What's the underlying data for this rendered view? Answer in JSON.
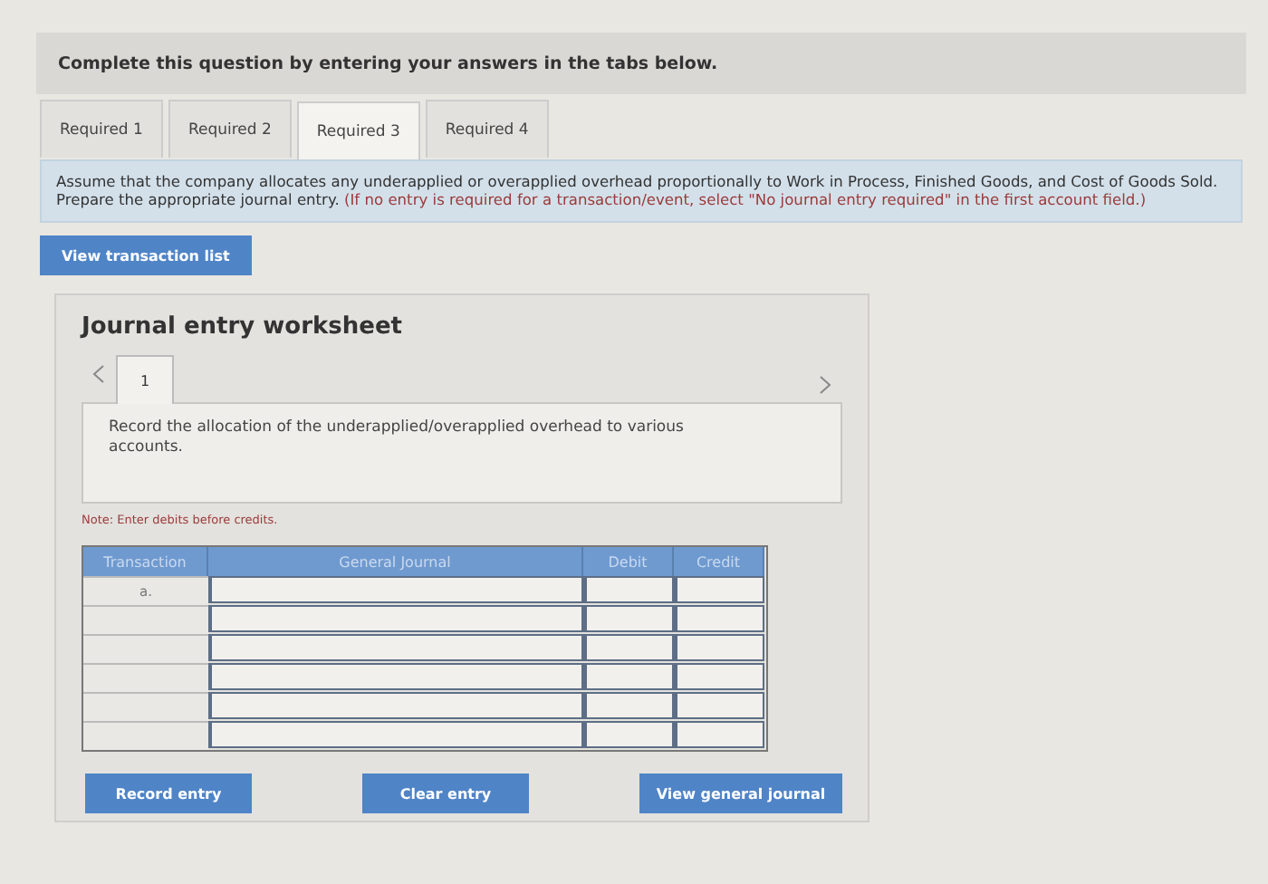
{
  "header": {
    "text": "Complete this question by entering your answers in the tabs below."
  },
  "tabs": [
    {
      "label": "Required 1",
      "selected": false
    },
    {
      "label": "Required 2",
      "selected": false
    },
    {
      "label": "Required 3",
      "selected": true
    },
    {
      "label": "Required 4",
      "selected": false
    }
  ],
  "instruction": {
    "text": "Assume that the company allocates any underapplied or overapplied overhead proportionally to Work in Process, Finished Goods, and Cost of Goods Sold. Prepare the appropriate journal entry.",
    "hint": "(If no entry is required for a transaction/event, select \"No journal entry required\" in the first account field.)"
  },
  "transaction_button": "View transaction list",
  "worksheet": {
    "title": "Journal entry worksheet",
    "entry_tabs": [
      {
        "label": "1",
        "selected": true
      }
    ],
    "description": "Record the allocation of the underapplied/overapplied overhead to various accounts.",
    "note": "Note: Enter debits before credits.",
    "table": {
      "columns": [
        "Transaction",
        "General Journal",
        "Debit",
        "Credit"
      ],
      "rows": [
        {
          "transaction": "a."
        },
        {},
        {},
        {},
        {},
        {}
      ]
    },
    "buttons": [
      "Record entry",
      "Clear entry",
      "View general journal"
    ]
  }
}
